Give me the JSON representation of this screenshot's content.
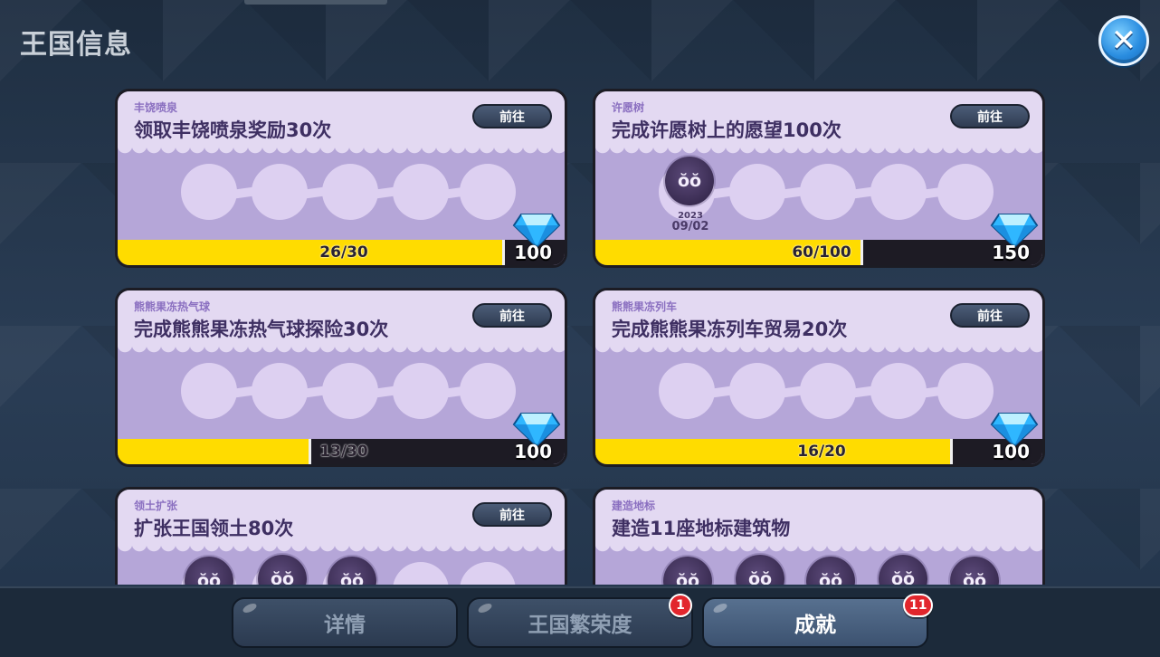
{
  "header": {
    "title": "王国信息",
    "close_icon": "close-icon"
  },
  "achievements": [
    {
      "category": "丰饶喷泉",
      "task": "领取丰饶喷泉奖励30次",
      "go_label": "前往",
      "progress_text": "26/30",
      "progress": 0.8667,
      "reward": "100",
      "stamps": []
    },
    {
      "category": "许愿树",
      "task": "完成许愿树上的愿望100次",
      "go_label": "前往",
      "progress_text": "60/100",
      "progress": 0.6,
      "reward": "150",
      "stamps": [
        {
          "glyph": "ŏŏ",
          "year": "2023",
          "date": "09/02"
        }
      ]
    },
    {
      "category": "熊熊果冻热气球",
      "task": "完成熊熊果冻热气球探险30次",
      "go_label": "前往",
      "progress_text": "13/30",
      "progress": 0.4333,
      "reward": "100",
      "stamps": []
    },
    {
      "category": "熊熊果冻列车",
      "task": "完成熊熊果冻列车贸易20次",
      "go_label": "前往",
      "progress_text": "16/20",
      "progress": 0.8,
      "reward": "100",
      "stamps": []
    },
    {
      "category": "领土扩张",
      "task": "扩张王国领土80次",
      "go_label": "前往",
      "stamps_completed": 3
    },
    {
      "category": "建造地标",
      "task": "建造11座地标建筑物",
      "stamps_completed": 5
    }
  ],
  "tabs": [
    {
      "label": "详情",
      "active": false,
      "badge": ""
    },
    {
      "label": "王国繁荣度",
      "active": false,
      "badge": "1"
    },
    {
      "label": "成就",
      "active": true,
      "badge": "11"
    }
  ],
  "colors": {
    "progress_fill": "#ffdc00",
    "card_bg": "#b5a6d8",
    "gem": "#2fb7ff",
    "badge": "#e2262d"
  }
}
